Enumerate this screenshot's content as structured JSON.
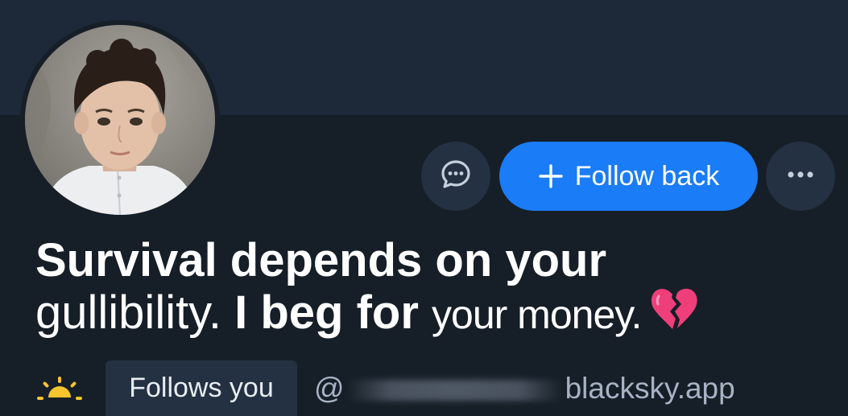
{
  "profile": {
    "display_name_part1": "Survival depends on your",
    "display_name_part2a": "gullibility. ",
    "display_name_part2b": "I beg for ",
    "display_name_part2c": "your money.",
    "emoji_icon": "broken-heart-icon",
    "follows_you_label": "Follows you",
    "handle_prefix": "@",
    "handle_suffix": "blacksky.app"
  },
  "actions": {
    "message_icon": "chat-bubble-icon",
    "follow_back_label": "Follow back",
    "more_icon": "ellipsis-icon"
  },
  "colors": {
    "background": "#161e27",
    "banner": "#1d2838",
    "button_secondary": "#243142",
    "accent": "#1a7cf6",
    "emoji": "#ee3f7a"
  }
}
